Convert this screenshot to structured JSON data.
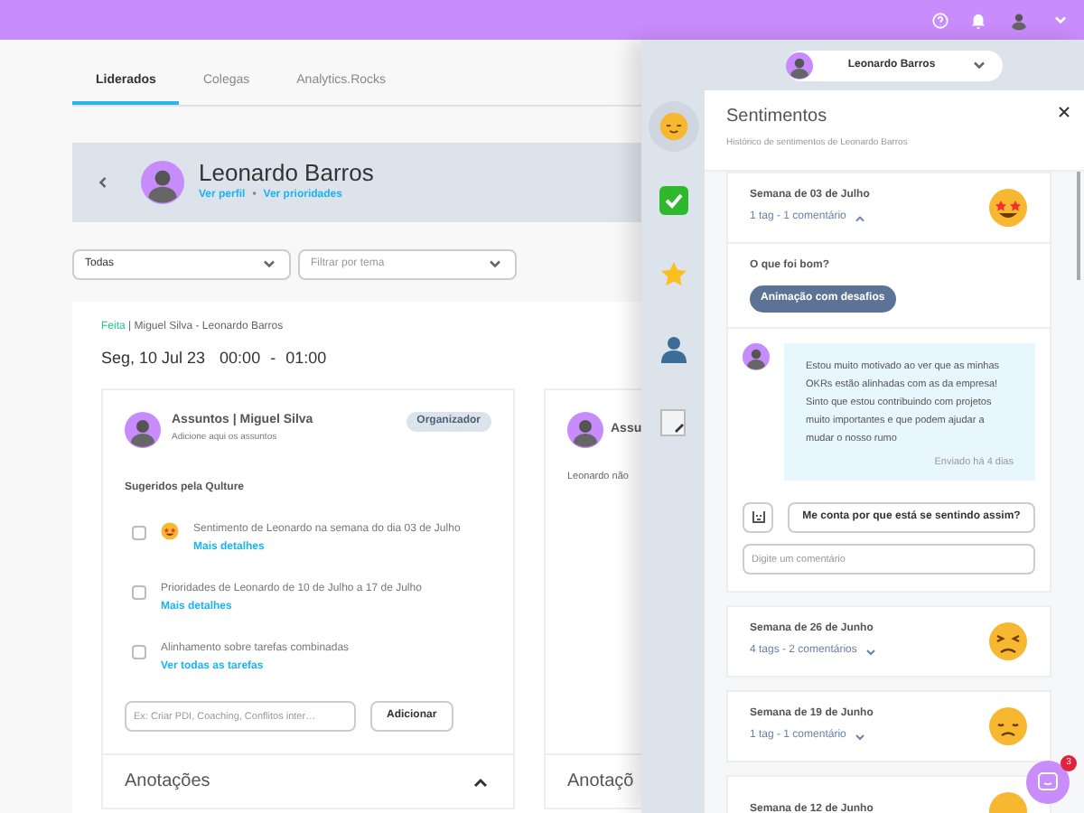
{
  "tabs": [
    {
      "label": "Liderados",
      "selected": true
    },
    {
      "label": "Colegas",
      "selected": false
    },
    {
      "label": "Analytics.Rocks",
      "selected": false
    }
  ],
  "profile": {
    "name": "Leonardo Barros",
    "links": [
      "Ver perfil",
      "Ver prioridades"
    ],
    "separator": "•"
  },
  "filters": [
    {
      "value": "Todas"
    },
    {
      "placeholder": "Filtrar por tema"
    }
  ],
  "meeting": {
    "status": "Feita",
    "divider": "|",
    "participants": "Miguel Silva - Leonardo Barros",
    "date": "Seg, 10 Jul 23",
    "time": "00:00 - 01:00"
  },
  "topics_card": {
    "title": "Assuntos | Miguel Silva",
    "subtitle": "Adicione aqui os assuntos",
    "badge": "Organizador",
    "section": "Sugeridos pela Qulture",
    "suggestions": [
      {
        "text": "Sentimento de Leonardo na semana do dia 03 de Julho",
        "link": "Mais detalhes",
        "checked": false,
        "kind": "feeling"
      },
      {
        "text": "Prioridades de Leonardo de 10 de Julho a 17 de Julho",
        "link": "Mais detalhes",
        "checked": false,
        "kind": "plain"
      },
      {
        "text": "Alinhamento sobre tarefas combinadas",
        "link": "Ver todas as tarefas",
        "checked": false,
        "kind": "plain"
      }
    ],
    "input": {
      "placeholder": "Ex: Criar PDI, Coaching, Conflitos inter…"
    },
    "button": "Adicionar",
    "notes": {
      "title": "Anotações",
      "expanded": true
    }
  },
  "other_card": {
    "title": "Assu",
    "text": "Leonardo não",
    "notes_title": "Anotaçõ"
  },
  "user_menu": {
    "name": "Leonardo Barros"
  },
  "side_icons": [
    {
      "kind": "face",
      "selected": true
    },
    {
      "kind": "check",
      "selected": false
    },
    {
      "kind": "star",
      "selected": false
    },
    {
      "kind": "person",
      "selected": false
    },
    {
      "kind": "notepad",
      "selected": false
    }
  ],
  "panel": {
    "title": "Sentimentos",
    "subtitle": "Histórico de sentimentos de Leonardo Barros",
    "weeks": [
      {
        "title": "Semana de 03 de Julho",
        "summary": "1 tag - 1 comentário",
        "kind": "starstruck",
        "expanded": true,
        "question": "O que foi bom?",
        "tags": [
          "Animação com desafios"
        ],
        "comments": [
          {
            "text": "Estou muito motivado ao ver que as minhas OKRs estão alinhadas com as da empresa! Sinto que estou contribuindo com projetos muito importantes e que podem ajudar a mudar o nosso rumo",
            "time": "Enviado há 4 dias"
          }
        ],
        "prompt_button": "Me conta por que está se sentindo assim?",
        "comment_input": {
          "placeholder": "Digite um comentário"
        }
      },
      {
        "title": "Semana de 26 de Junho",
        "summary": "4 tags - 2 comentários",
        "kind": "persevering",
        "expanded": false
      },
      {
        "title": "Semana de 19 de Junho",
        "summary": "1 tag - 1 comentário",
        "kind": "disappointed",
        "expanded": false
      },
      {
        "title": "Semana de 12 de Junho",
        "kind": "plain",
        "expanded": false
      }
    ]
  },
  "chat": {
    "badge": "3"
  }
}
